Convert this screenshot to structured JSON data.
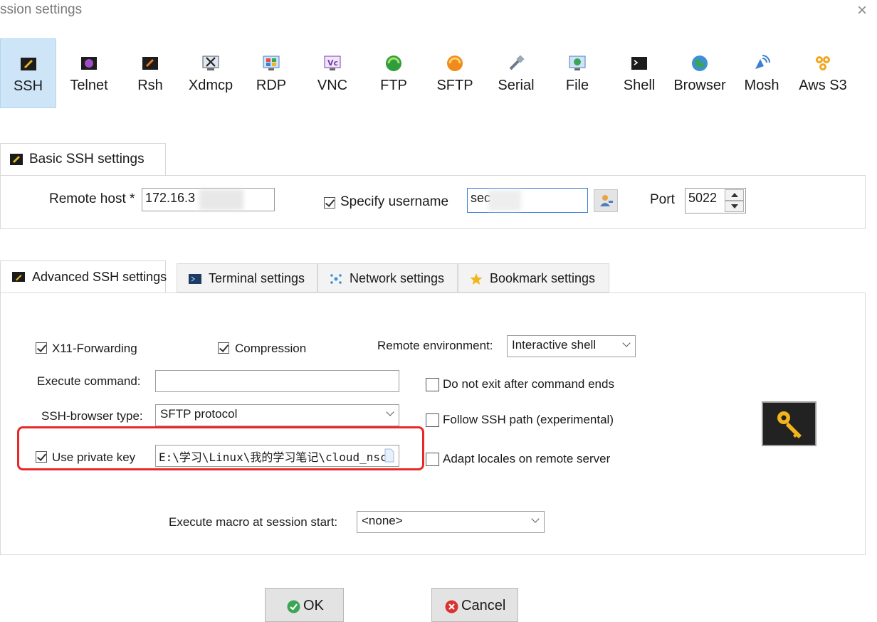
{
  "window": {
    "title": "ssion settings",
    "close_glyph": "×"
  },
  "session_types": [
    {
      "label": "SSH",
      "icon": "ssh-icon",
      "selected": true
    },
    {
      "label": "Telnet",
      "icon": "telnet-icon"
    },
    {
      "label": "Rsh",
      "icon": "rsh-icon"
    },
    {
      "label": "Xdmcp",
      "icon": "xdmcp-icon"
    },
    {
      "label": "RDP",
      "icon": "rdp-icon"
    },
    {
      "label": "VNC",
      "icon": "vnc-icon"
    },
    {
      "label": "FTP",
      "icon": "ftp-icon"
    },
    {
      "label": "SFTP",
      "icon": "sftp-icon"
    },
    {
      "label": "Serial",
      "icon": "serial-icon"
    },
    {
      "label": "File",
      "icon": "file-icon"
    },
    {
      "label": "Shell",
      "icon": "shell-icon"
    },
    {
      "label": "Browser",
      "icon": "browser-icon"
    },
    {
      "label": "Mosh",
      "icon": "mosh-icon"
    },
    {
      "label": "Aws S3",
      "icon": "aws-s3-icon"
    }
  ],
  "basic": {
    "tab_label": "Basic SSH settings",
    "remote_host_label": "Remote host *",
    "remote_host_value": "172.16.3",
    "specify_username_label": "Specify username",
    "specify_username_checked": true,
    "username_value": "sec",
    "port_label": "Port",
    "port_value": "5022"
  },
  "advanced_tabs": [
    {
      "label": "Advanced SSH settings",
      "icon": "ssh-icon",
      "active": true
    },
    {
      "label": "Terminal settings",
      "icon": "terminal-icon"
    },
    {
      "label": "Network settings",
      "icon": "network-icon"
    },
    {
      "label": "Bookmark settings",
      "icon": "star-icon"
    }
  ],
  "advanced": {
    "x11_label": "X11-Forwarding",
    "x11_checked": true,
    "compression_label": "Compression",
    "compression_checked": true,
    "remote_env_label": "Remote environment:",
    "remote_env_value": "Interactive shell",
    "exec_cmd_label": "Execute command:",
    "exec_cmd_value": "",
    "no_exit_label": "Do not exit after command ends",
    "no_exit_checked": false,
    "browser_type_label": "SSH-browser type:",
    "browser_type_value": "SFTP protocol",
    "follow_path_label": "Follow SSH path (experimental)",
    "follow_path_checked": false,
    "private_key_label": "Use private key",
    "private_key_checked": true,
    "private_key_value": "E:\\学习\\Linux\\我的学习笔记\\cloud_nsc",
    "adapt_locales_label": "Adapt locales on remote server",
    "adapt_locales_checked": false,
    "macro_label": "Execute macro at session start:",
    "macro_value": "<none>"
  },
  "colors": {
    "selected_bg": "#cde5f7",
    "highlight_red": "#e8282b",
    "ok_green": "#3aa655",
    "cancel_red": "#d8332f",
    "key_bg": "#222222",
    "key_gold": "#f2b51b"
  },
  "buttons": {
    "ok": "OK",
    "cancel": "Cancel"
  }
}
